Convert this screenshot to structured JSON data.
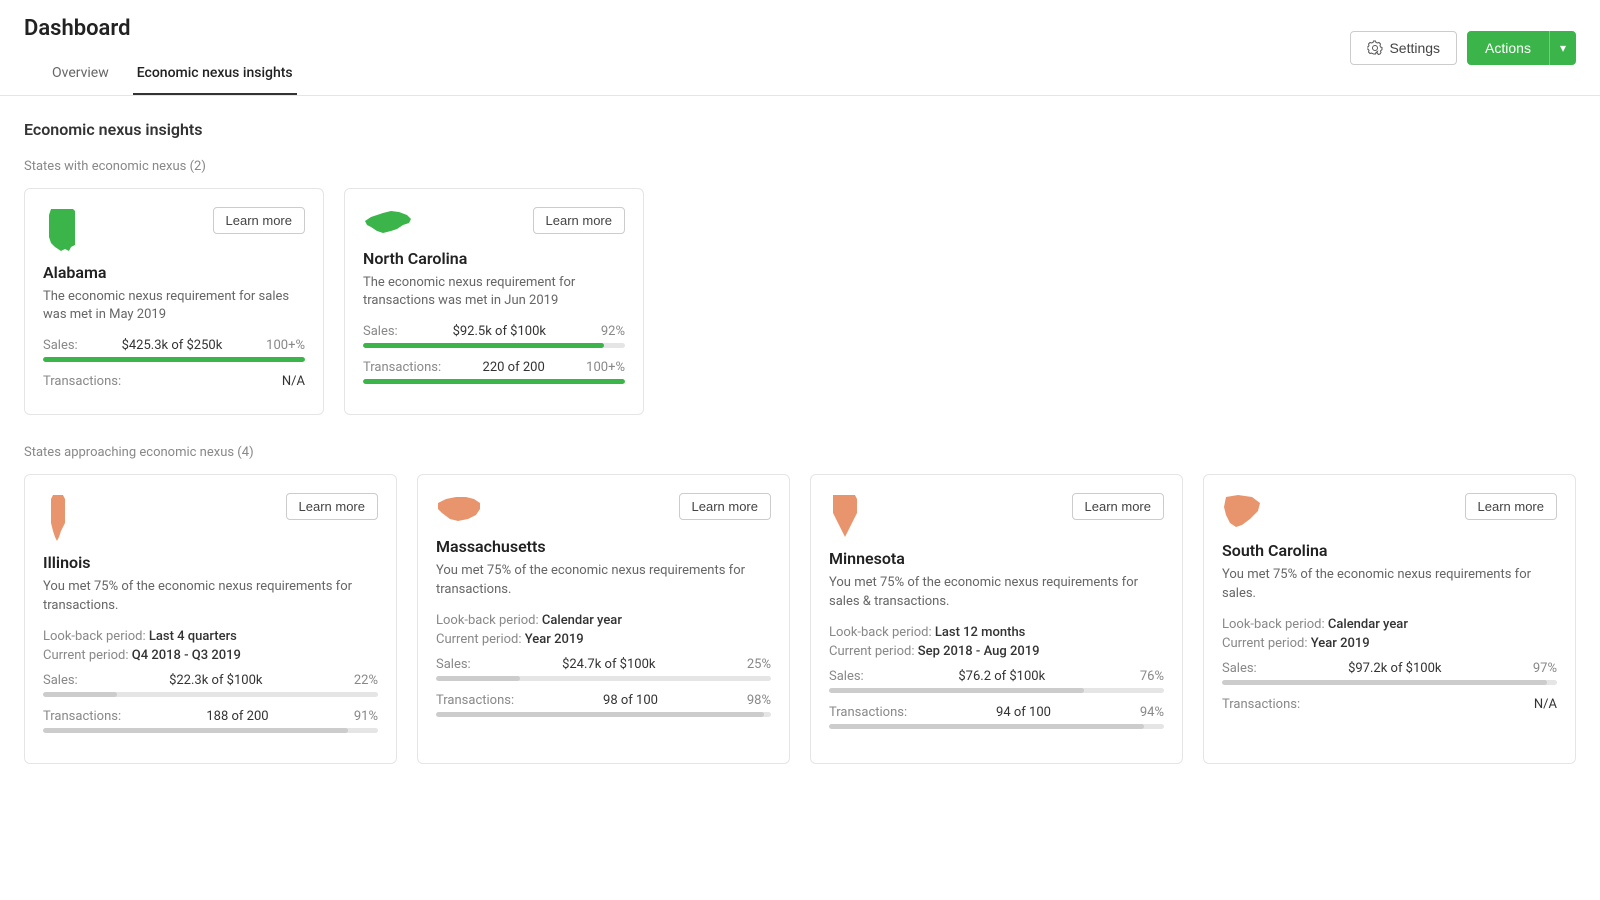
{
  "page": {
    "title": "Dashboard",
    "settings_label": "Settings",
    "actions_label": "Actions"
  },
  "tabs": [
    {
      "id": "overview",
      "label": "Overview",
      "active": false
    },
    {
      "id": "economic-nexus-insights",
      "label": "Economic nexus insights",
      "active": true
    }
  ],
  "section": {
    "title": "Economic nexus insights",
    "nexus_states_title": "States with economic nexus (2)",
    "approaching_states_title": "States approaching economic nexus (4)"
  },
  "nexus_states": [
    {
      "state": "Alabama",
      "description": "The economic nexus requirement for sales was met in May 2019",
      "learn_more": "Learn more",
      "sales_label": "Sales:",
      "sales_value": "$425.3k of $250k",
      "sales_pct": "100+%",
      "sales_pct_num": 100,
      "transactions_label": "Transactions:",
      "transactions_value": "N/A",
      "transactions_pct": null,
      "transactions_pct_num": 0,
      "shape": "alabama"
    },
    {
      "state": "North Carolina",
      "description": "The economic nexus requirement for transactions was met in Jun 2019",
      "learn_more": "Learn more",
      "sales_label": "Sales:",
      "sales_value": "$92.5k of $100k",
      "sales_pct": "92%",
      "sales_pct_num": 92,
      "transactions_label": "Transactions:",
      "transactions_value": "220 of 200",
      "transactions_pct": "100+%",
      "transactions_pct_num": 100,
      "shape": "nc"
    }
  ],
  "approaching_states": [
    {
      "state": "Illinois",
      "description": "You met 75% of the economic nexus requirements for transactions.",
      "learn_more": "Learn more",
      "lookback_label": "Look-back period:",
      "lookback_value": "Last 4 quarters",
      "current_period_label": "Current period:",
      "current_period_value": "Q4 2018 - Q3 2019",
      "sales_label": "Sales:",
      "sales_value": "$22.3k of $100k",
      "sales_pct": "22%",
      "sales_pct_num": 22,
      "transactions_label": "Transactions:",
      "transactions_value": "188 of 200",
      "transactions_pct": "91%",
      "transactions_pct_num": 91,
      "shape": "illinois"
    },
    {
      "state": "Massachusetts",
      "description": "You met 75% of the economic nexus requirements for transactions.",
      "learn_more": "Learn more",
      "lookback_label": "Look-back period:",
      "lookback_value": "Calendar year",
      "current_period_label": "Current period:",
      "current_period_value": "Year 2019",
      "sales_label": "Sales:",
      "sales_value": "$24.7k of $100k",
      "sales_pct": "25%",
      "sales_pct_num": 25,
      "transactions_label": "Transactions:",
      "transactions_value": "98 of 100",
      "transactions_pct": "98%",
      "transactions_pct_num": 98,
      "shape": "massachusetts"
    },
    {
      "state": "Minnesota",
      "description": "You met 75% of the economic nexus requirements for sales & transactions.",
      "learn_more": "Learn more",
      "lookback_label": "Look-back period:",
      "lookback_value": "Last 12 months",
      "current_period_label": "Current period:",
      "current_period_value": "Sep 2018 - Aug 2019",
      "sales_label": "Sales:",
      "sales_value": "$76.2 of $100k",
      "sales_pct": "76%",
      "sales_pct_num": 76,
      "transactions_label": "Transactions:",
      "transactions_value": "94 of 100",
      "transactions_pct": "94%",
      "transactions_pct_num": 94,
      "shape": "minnesota"
    },
    {
      "state": "South Carolina",
      "description": "You met 75% of the economic nexus requirements for sales.",
      "learn_more": "Learn more",
      "lookback_label": "Look-back period:",
      "lookback_value": "Calendar year",
      "current_period_label": "Current period:",
      "current_period_value": "Year 2019",
      "sales_label": "Sales:",
      "sales_value": "$97.2k of $100k",
      "sales_pct": "97%",
      "sales_pct_num": 97,
      "transactions_label": "Transactions:",
      "transactions_value": "N/A",
      "transactions_pct": null,
      "transactions_pct_num": 0,
      "shape": "south-carolina"
    }
  ]
}
